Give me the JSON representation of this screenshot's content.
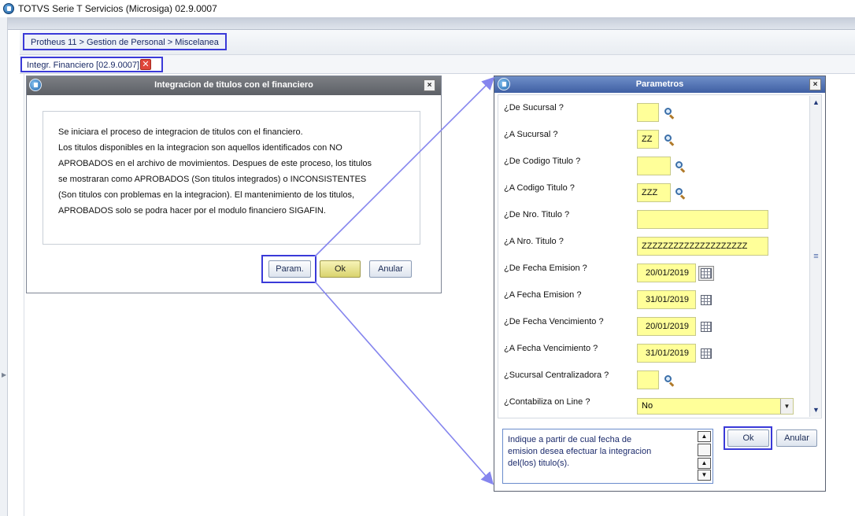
{
  "window": {
    "title": "TOTVS Serie T Servicios (Microsiga) 02.9.0007"
  },
  "breadcrumb": "Protheus 11 > Gestion de Personal > Miscelanea",
  "tab": {
    "label": "Integr. Financiero [02.9.0007]",
    "close_icon": "close-icon"
  },
  "dialog_main": {
    "title": "Integracion de titulos con el financiero",
    "close": "×",
    "message_lines": [
      "Se iniciara el proceso de integracion de titulos con el financiero.",
      "Los titulos disponibles en la integracion son aquellos identificados con NO",
      "APROBADOS en el archivo de movimientos. Despues de este proceso, los titulos",
      "se mostraran como APROBADOS (Son titulos integrados) o INCONSISTENTES",
      "(Son titulos con problemas en la integracion). El mantenimiento de los titulos,",
      "APROBADOS solo se podra hacer por el modulo financiero SIGAFIN."
    ],
    "buttons": {
      "param": "Param.",
      "ok": "Ok",
      "cancel": "Anular"
    }
  },
  "dialog_params": {
    "title": "Parametros",
    "close": "×",
    "fields": [
      {
        "label": "¿De Sucursal ?",
        "value": "",
        "icon": "search-icon"
      },
      {
        "label": "¿A Sucursal ?",
        "value": "ZZ",
        "icon": "search-icon"
      },
      {
        "label": "¿De Codigo Titulo ?",
        "value": "",
        "icon": "search-icon"
      },
      {
        "label": "¿A Codigo Titulo ?",
        "value": "ZZZ",
        "icon": "search-icon"
      },
      {
        "label": "¿De Nro. Titulo ?",
        "value": "",
        "icon": ""
      },
      {
        "label": "¿A Nro. Titulo ?",
        "value": "ZZZZZZZZZZZZZZZZZZZZ",
        "icon": ""
      },
      {
        "label": "¿De Fecha Emision ?",
        "value": "20/01/2019",
        "icon": "calendar-icon"
      },
      {
        "label": "¿A Fecha Emision ?",
        "value": "31/01/2019",
        "icon": "calendar-icon"
      },
      {
        "label": "¿De Fecha Vencimiento ?",
        "value": "20/01/2019",
        "icon": "calendar-icon"
      },
      {
        "label": "¿A Fecha Vencimiento ?",
        "value": "31/01/2019",
        "icon": "calendar-icon"
      },
      {
        "label": "¿Sucursal Centralizadora ?",
        "value": "",
        "icon": "search-icon"
      },
      {
        "label": "¿Contabiliza on Line ?",
        "value": "No",
        "icon": "dropdown-icon"
      }
    ],
    "help_lines": [
      "Indique a partir de cual fecha de",
      "emision desea efectuar la integracion",
      "del(los) titulo(s)."
    ],
    "buttons": {
      "ok": "Ok",
      "cancel": "Anular"
    }
  },
  "colors": {
    "highlight": "#3a3ad8",
    "field_bg": "#ffff99",
    "param_title": "#4f6fb3",
    "main_title": "#6b6e73"
  }
}
